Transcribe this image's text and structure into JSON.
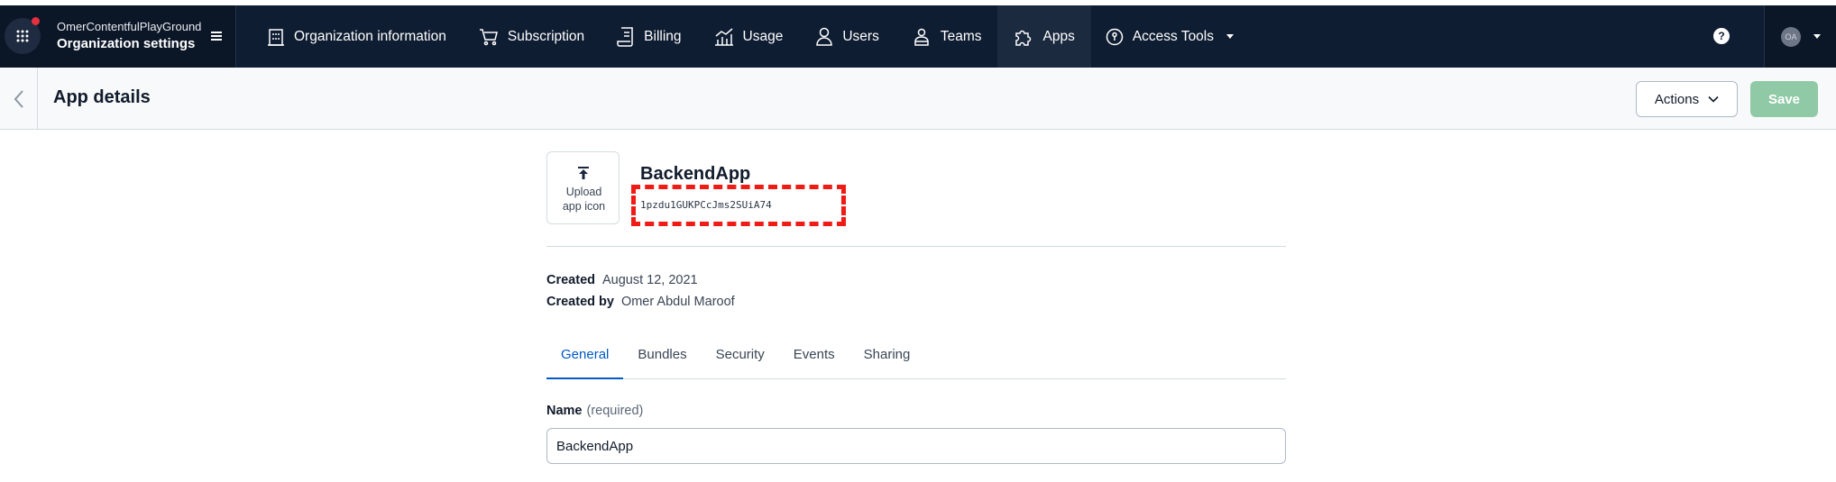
{
  "org": {
    "name": "OmerContentfulPlayGround",
    "title": "Organization settings"
  },
  "nav": {
    "items": [
      {
        "label": "Organization information",
        "icon": "building-icon"
      },
      {
        "label": "Subscription",
        "icon": "cart-icon"
      },
      {
        "label": "Billing",
        "icon": "invoice-icon"
      },
      {
        "label": "Usage",
        "icon": "chart-icon"
      },
      {
        "label": "Users",
        "icon": "user-icon"
      },
      {
        "label": "Teams",
        "icon": "teams-icon"
      },
      {
        "label": "Apps",
        "icon": "puzzle-icon"
      },
      {
        "label": "Access Tools",
        "icon": "access-icon"
      }
    ],
    "active": "Apps",
    "help": "?"
  },
  "profile": {
    "initials": "OA"
  },
  "page": {
    "title": "App details",
    "actions_label": "Actions",
    "save_label": "Save"
  },
  "app": {
    "upload_label_line1": "Upload",
    "upload_label_line2": "app icon",
    "name": "BackendApp",
    "id": "1pzdu1GUKPCcJms2SUiA74",
    "created_label": "Created",
    "created_value": "August 12, 2021",
    "created_by_label": "Created by",
    "created_by_value": "Omer Abdul Maroof"
  },
  "tabs": [
    {
      "label": "General",
      "active": true
    },
    {
      "label": "Bundles",
      "active": false
    },
    {
      "label": "Security",
      "active": false
    },
    {
      "label": "Events",
      "active": false
    },
    {
      "label": "Sharing",
      "active": false
    }
  ],
  "form": {
    "name_label": "Name",
    "name_required": "(required)",
    "name_value": "BackendApp"
  },
  "colors": {
    "topbar": "#0f1d32",
    "accent": "#0059c8",
    "save": "#8fc9a5",
    "highlight": "#ee1c14"
  }
}
